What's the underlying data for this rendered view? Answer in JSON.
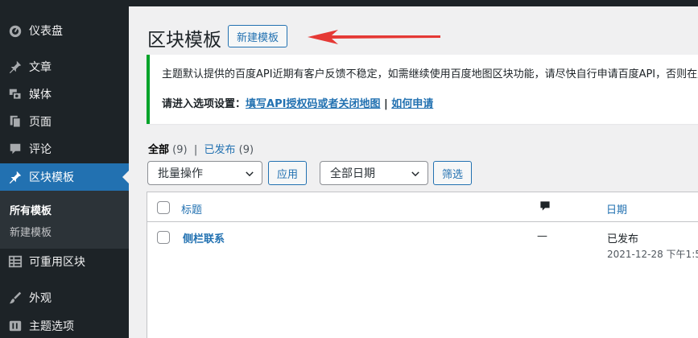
{
  "sidebar": {
    "items": [
      {
        "label": "仪表盘",
        "icon": "dashboard-icon"
      },
      {
        "label": "文章",
        "icon": "pin-icon"
      },
      {
        "label": "媒体",
        "icon": "media-icon"
      },
      {
        "label": "页面",
        "icon": "page-icon"
      },
      {
        "label": "评论",
        "icon": "comment-icon"
      },
      {
        "label": "区块模板",
        "icon": "pin-icon"
      },
      {
        "label": "可重用区块",
        "icon": "table-icon"
      },
      {
        "label": "外观",
        "icon": "brush-icon"
      },
      {
        "label": "主题选项",
        "icon": "theme-options-icon"
      }
    ],
    "submenu": [
      "所有模板",
      "新建模板"
    ]
  },
  "header": {
    "title": "区块模板",
    "add_new": "新建模板"
  },
  "notice": {
    "text": "主题默认提供的百度API近期有客户反馈不稳定，如需继续使用百度地图区块功能，请尽快自行申请百度API，否则在后",
    "prefix": "请进入选项设置：",
    "link1": "填写API授权码或者关闭地图",
    "separator": " | ",
    "link2": "如何申请"
  },
  "filters": {
    "all_label": "全部",
    "all_count": "(9)",
    "separator": "|",
    "published_label": "已发布",
    "published_count": "(9)"
  },
  "actions": {
    "bulk_select": "批量操作",
    "apply": "应用",
    "date_select": "全部日期",
    "filter": "筛选"
  },
  "table": {
    "headers": {
      "title": "标题",
      "date": "日期"
    },
    "rows": [
      {
        "title": "侧栏联系",
        "comments": "—",
        "status": "已发布",
        "date": "2021-12-28 下午1:5"
      }
    ]
  },
  "colors": {
    "sidebar_bg": "#1d2327",
    "accent": "#2271b1",
    "notice_border": "#00a32a",
    "arrow": "#e53935"
  }
}
